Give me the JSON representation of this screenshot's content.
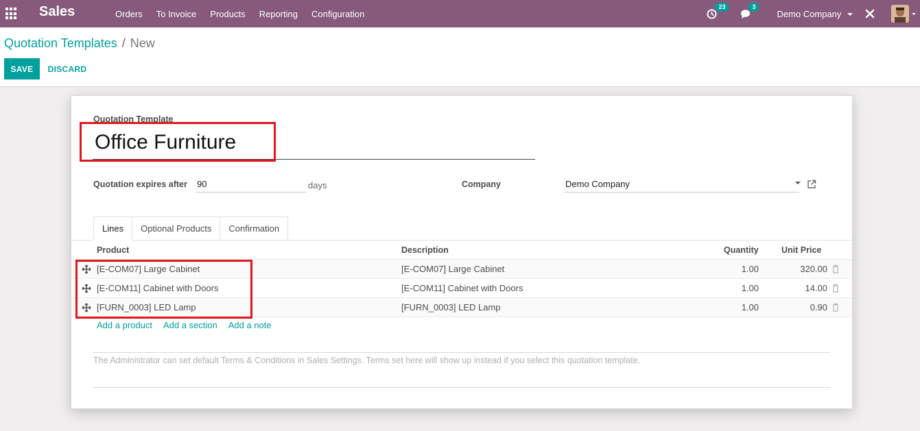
{
  "navbar": {
    "brand": "Sales",
    "menu": [
      "Orders",
      "To Invoice",
      "Products",
      "Reporting",
      "Configuration"
    ],
    "activity_count": "23",
    "message_count": "3",
    "company": "Demo Company",
    "icons": [
      "apps-grid-icon",
      "clock-icon",
      "chat-icon",
      "tools-icon",
      "avatar"
    ]
  },
  "breadcrumb": {
    "parent": "Quotation Templates",
    "separator": "/",
    "current": "New"
  },
  "buttons": {
    "save": "SAVE",
    "discard": "DISCARD"
  },
  "form": {
    "template_label": "Quotation Template",
    "template_name": "Office Furniture",
    "expires_label": "Quotation expires after",
    "expires_value": "90",
    "expires_unit": "days",
    "company_label": "Company",
    "company_value": "Demo Company"
  },
  "tabs": [
    "Lines",
    "Optional Products",
    "Confirmation"
  ],
  "table": {
    "columns": {
      "product": "Product",
      "description": "Description",
      "quantity": "Quantity",
      "unit_price": "Unit Price"
    },
    "rows": [
      {
        "product": "[E-COM07] Large Cabinet",
        "description": "[E-COM07] Large Cabinet",
        "quantity": "1.00",
        "unit_price": "320.00"
      },
      {
        "product": "[E-COM11] Cabinet with Doors",
        "description": "[E-COM11] Cabinet with Doors",
        "quantity": "1.00",
        "unit_price": "14.00"
      },
      {
        "product": "[FURN_0003] LED Lamp",
        "description": "[FURN_0003] LED Lamp",
        "quantity": "1.00",
        "unit_price": "0.90"
      }
    ]
  },
  "add_links": {
    "product": "Add a product",
    "section": "Add a section",
    "note": "Add a note"
  },
  "terms_placeholder": "The Administrator can set default Terms & Conditions in Sales Settings. Terms set here will show up instead if you select this quotation template.",
  "colors": {
    "navbar": "#875a7b",
    "accent": "#00a09d",
    "highlight": "#e0161e"
  }
}
